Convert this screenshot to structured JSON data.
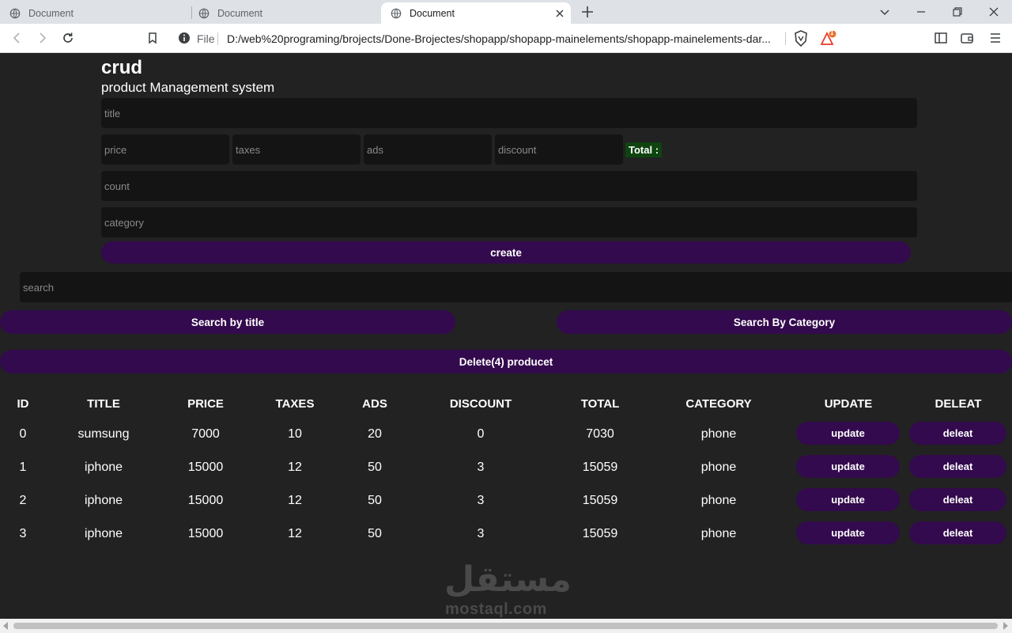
{
  "browser": {
    "tabs": [
      {
        "label": "Document",
        "active": false
      },
      {
        "label": "Document",
        "active": false
      },
      {
        "label": "Document",
        "active": true
      }
    ],
    "url_scheme": "File",
    "url": "D:/web%20programing/brojects/Done-Brojectes/shopapp/shopapp-mainelements/shopapp-mainelements-dar...",
    "notification_count": "1"
  },
  "app": {
    "title": "crud",
    "subtitle": "product Management system",
    "form": {
      "title_placeholder": "title",
      "price_placeholder": "price",
      "taxes_placeholder": "taxes",
      "ads_placeholder": "ads",
      "discount_placeholder": "discount",
      "total_label": "Total :",
      "count_placeholder": "count",
      "category_placeholder": "category",
      "create_label": "create"
    },
    "search": {
      "placeholder": "search",
      "by_title_label": "Search by title",
      "by_category_label": "Search By Category"
    },
    "delete_all_label": "Delete(4) producet",
    "table": {
      "headers": [
        "ID",
        "title",
        "price",
        "taxes",
        "ads",
        "discount",
        "total",
        "category",
        "update",
        "deleat"
      ],
      "rows": [
        {
          "id": "0",
          "title": "sumsung",
          "price": "7000",
          "taxes": "10",
          "ads": "20",
          "discount": "0",
          "total": "7030",
          "category": "phone",
          "update": "update",
          "delete": "deleat"
        },
        {
          "id": "1",
          "title": "iphone",
          "price": "15000",
          "taxes": "12",
          "ads": "50",
          "discount": "3",
          "total": "15059",
          "category": "phone",
          "update": "update",
          "delete": "deleat"
        },
        {
          "id": "2",
          "title": "iphone",
          "price": "15000",
          "taxes": "12",
          "ads": "50",
          "discount": "3",
          "total": "15059",
          "category": "phone",
          "update": "update",
          "delete": "deleat"
        },
        {
          "id": "3",
          "title": "iphone",
          "price": "15000",
          "taxes": "12",
          "ads": "50",
          "discount": "3",
          "total": "15059",
          "category": "phone",
          "update": "update",
          "delete": "deleat"
        }
      ]
    }
  },
  "watermark": {
    "arabic": "مستقل",
    "latin": "mostaql.com"
  },
  "colors": {
    "page_bg": "#222222",
    "input_bg": "#141414",
    "button": "#330a4d",
    "total_badge": "#0f4410"
  }
}
